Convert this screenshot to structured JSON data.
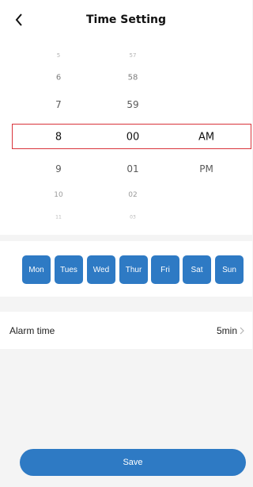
{
  "header": {
    "title": "Time Setting",
    "back_icon": "chevron-left-icon"
  },
  "picker": {
    "hours": [
      "5",
      "6",
      "7",
      "8",
      "9",
      "10",
      "11"
    ],
    "minutes": [
      "57",
      "58",
      "59",
      "00",
      "01",
      "02",
      "03"
    ],
    "periods": [
      "AM",
      "PM"
    ],
    "selected": {
      "hour": "8",
      "minute": "00",
      "period": "AM"
    },
    "selection_color": "#d9343b"
  },
  "days": {
    "items": [
      "Mon",
      "Tues",
      "Wed",
      "Thur",
      "Fri",
      "Sat",
      "Sun"
    ],
    "color": "#2e7ac4"
  },
  "alarm": {
    "label": "Alarm time",
    "value": "5min",
    "chevron_icon": "chevron-right-icon"
  },
  "save": {
    "label": "Save",
    "color": "#2e7ac4"
  }
}
